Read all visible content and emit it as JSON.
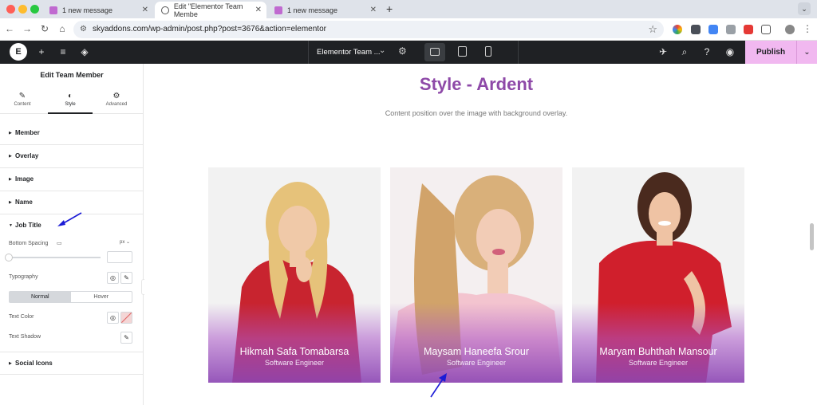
{
  "browser": {
    "tabs": [
      {
        "title": "1 new message",
        "active": false
      },
      {
        "title": "Edit \"Elementor Team Membe",
        "active": true
      },
      {
        "title": "1 new message",
        "active": false
      }
    ],
    "url": "skyaddons.com/wp-admin/post.php?post=3676&action=elementor"
  },
  "editor": {
    "document_title": "Elementor Team ...",
    "publish_label": "Publish",
    "accent": "#f1b8f0"
  },
  "panel": {
    "title": "Edit Team Member",
    "tabs": [
      {
        "label": "Content",
        "icon": "pencil-icon"
      },
      {
        "label": "Style",
        "icon": "contrast-icon"
      },
      {
        "label": "Advanced",
        "icon": "gear-icon"
      }
    ],
    "sections": {
      "member": "Member",
      "overlay": "Overlay",
      "image": "Image",
      "name": "Name",
      "job_title": "Job Title",
      "social_icons": "Social Icons"
    },
    "job_title_controls": {
      "bottom_spacing_label": "Bottom Spacing",
      "unit": "px",
      "typography_label": "Typography",
      "normal_label": "Normal",
      "hover_label": "Hover",
      "text_color_label": "Text Color",
      "text_shadow_label": "Text Shadow"
    }
  },
  "canvas": {
    "heading": "Style - Ardent",
    "subheading": "Content position over the image with background overlay.",
    "heading_color": "#8e49a8",
    "members": [
      {
        "name": "Hikmah Safa Tomabarsa",
        "job": "Software Engineer"
      },
      {
        "name": "Maysam Haneefa Srour",
        "job": "Software Engineer"
      },
      {
        "name": "Maryam Buhthah Mansour",
        "job": "Software Engineer"
      }
    ]
  }
}
